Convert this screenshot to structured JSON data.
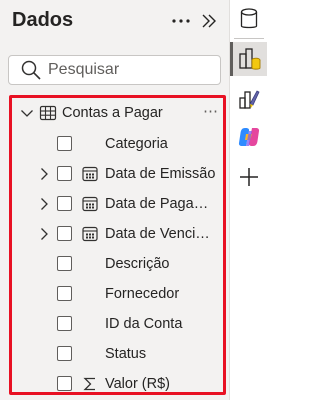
{
  "pane": {
    "title": "Dados",
    "more_icon": "more-icon",
    "collapse_icon": "double-chevron-right-icon"
  },
  "search": {
    "placeholder": "Pesquisar",
    "icon": "search-icon"
  },
  "table": {
    "name": "Contas a Pagar",
    "expanded": true,
    "icon": "table-icon",
    "more_glyph": "⋯",
    "fields": [
      {
        "label": "Categoria",
        "expandable": false,
        "icon": ""
      },
      {
        "label": "Data de Emissão",
        "expandable": true,
        "icon": "calendar-icon"
      },
      {
        "label": "Data de Pagamento",
        "expandable": true,
        "icon": "calendar-icon"
      },
      {
        "label": "Data de Vencimento",
        "expandable": true,
        "icon": "calendar-icon"
      },
      {
        "label": "Descrição",
        "expandable": false,
        "icon": ""
      },
      {
        "label": "Fornecedor",
        "expandable": false,
        "icon": ""
      },
      {
        "label": "ID da Conta",
        "expandable": false,
        "icon": ""
      },
      {
        "label": "Status",
        "expandable": false,
        "icon": ""
      },
      {
        "label": "Valor (R$)",
        "expandable": false,
        "icon": "sigma-icon"
      }
    ]
  },
  "rail": {
    "items": [
      "database-icon",
      "build-visual-icon",
      "format-paint-icon",
      "copilot-icon",
      "add-icon"
    ],
    "active_index": 1
  },
  "colors": {
    "pane_bg": "#f3f2f1",
    "highlight_border": "#e81123",
    "text": "#252423"
  }
}
